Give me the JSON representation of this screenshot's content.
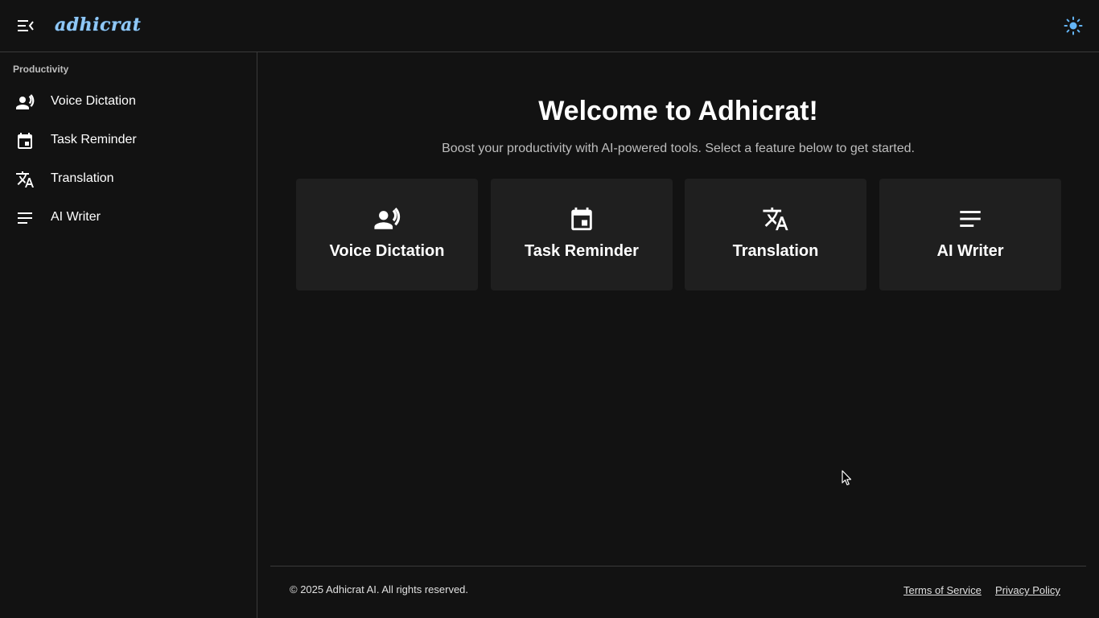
{
  "header": {
    "logo_text": "adhicrat",
    "menu_icon": "menu-open-icon",
    "theme_icon": "sun-icon"
  },
  "sidebar": {
    "section_title": "Productivity",
    "items": [
      {
        "label": "Voice Dictation",
        "icon": "record-voice-icon"
      },
      {
        "label": "Task Reminder",
        "icon": "calendar-event-icon"
      },
      {
        "label": "Translation",
        "icon": "translate-icon"
      },
      {
        "label": "AI Writer",
        "icon": "notes-icon"
      }
    ]
  },
  "main": {
    "title": "Welcome to Adhicrat!",
    "subtitle": "Boost your productivity with AI-powered tools. Select a feature below to get started.",
    "cards": [
      {
        "label": "Voice Dictation",
        "icon": "record-voice-icon"
      },
      {
        "label": "Task Reminder",
        "icon": "calendar-event-icon"
      },
      {
        "label": "Translation",
        "icon": "translate-icon"
      },
      {
        "label": "AI Writer",
        "icon": "notes-icon"
      }
    ]
  },
  "footer": {
    "copyright": "© 2025 Adhicrat AI. All rights reserved.",
    "terms": "Terms of Service",
    "privacy": "Privacy Policy"
  },
  "colors": {
    "background": "#121212",
    "card": "#1f1f1f",
    "accent": "#64b5f6",
    "border": "#3a3a3a"
  }
}
